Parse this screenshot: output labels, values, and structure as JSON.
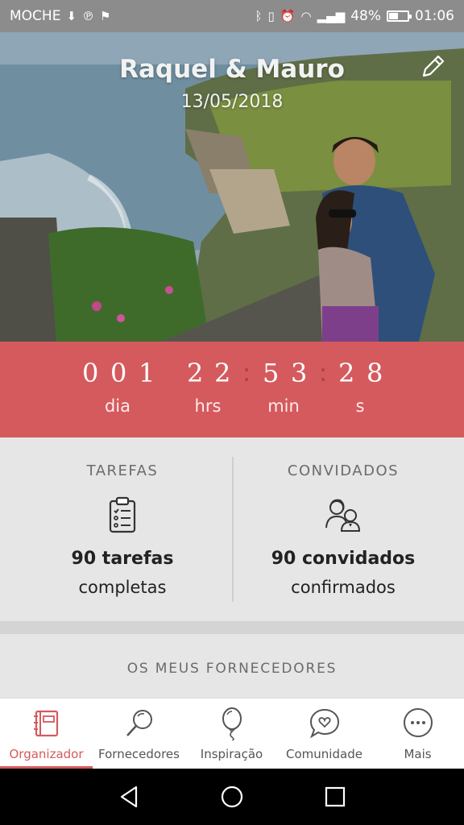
{
  "status_bar": {
    "carrier": "MOCHE",
    "battery": "48%",
    "battery_level": 0.48,
    "time": "01:06"
  },
  "header": {
    "couple_name": "Raquel & Mauro",
    "wedding_date": "13/05/2018"
  },
  "countdown": {
    "days_digits": [
      "0",
      "0",
      "1"
    ],
    "hours_digits": [
      "2",
      "2"
    ],
    "minutes_digits": [
      "5",
      "3"
    ],
    "seconds_digits": [
      "2",
      "8"
    ],
    "labels": {
      "days": "dia",
      "hours": "hrs",
      "minutes": "min",
      "seconds": "s"
    },
    "color": "#d45a5e"
  },
  "stats": {
    "tasks": {
      "title": "TAREFAS",
      "number": "90 tarefas",
      "sub": "completas",
      "icon": "clipboard-icon"
    },
    "guests": {
      "title": "CONVIDADOS",
      "number": "90 convidados",
      "sub": "confirmados",
      "icon": "guests-icon"
    }
  },
  "suppliers": {
    "title": "OS MEUS FORNECEDORES"
  },
  "bottom_nav": {
    "items": [
      {
        "label": "Organizador",
        "icon": "planner-icon",
        "active": true
      },
      {
        "label": "Fornecedores",
        "icon": "search-icon",
        "active": false
      },
      {
        "label": "Inspiração",
        "icon": "balloon-icon",
        "active": false
      },
      {
        "label": "Comunidade",
        "icon": "chat-heart-icon",
        "active": false
      },
      {
        "label": "Mais",
        "icon": "more-icon",
        "active": false
      }
    ],
    "accent_color": "#d45a5e"
  }
}
